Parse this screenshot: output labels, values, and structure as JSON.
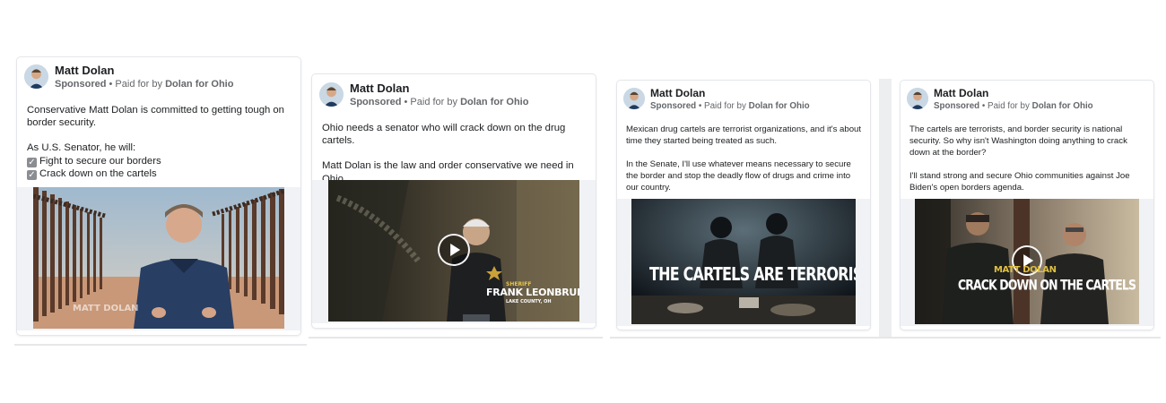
{
  "ads": [
    {
      "advertiser": "Matt Dolan",
      "sponsored": "Sponsored",
      "paid_prefix": "• Paid for by",
      "payer": "Dolan for Ohio",
      "text_lines": [
        "Conservative Matt Dolan is committed to getting tough on border security.",
        "",
        "As U.S. Senator, he will:"
      ],
      "checklist": [
        "Fight to secure our borders",
        "Crack down on the cartels"
      ],
      "video_caption": "MATT DOLAN"
    },
    {
      "advertiser": "Matt Dolan",
      "sponsored": "Sponsored",
      "paid_prefix": "• Paid for by",
      "payer": "Dolan for Ohio",
      "text_lines": [
        "Ohio needs a senator who will crack down on the drug cartels.",
        "",
        "Matt Dolan is the law and order conservative we need in Ohio."
      ],
      "video_caption_small": "SHERIFF",
      "video_caption": "FRANK LEONBRUNO",
      "video_caption_sub": "LAKE COUNTY, OH"
    },
    {
      "advertiser": "Matt Dolan",
      "sponsored": "Sponsored",
      "paid_prefix": "• Paid for by",
      "payer": "Dolan for Ohio",
      "text_lines": [
        "Mexican drug cartels are terrorist organizations, and it's about time they started being treated as such.",
        "",
        "In the Senate, I'll use whatever means necessary to secure the border and stop the deadly flow of drugs and crime into our country."
      ],
      "video_caption": "THE CARTELS ARE TERRORISTS"
    },
    {
      "advertiser": "Matt Dolan",
      "sponsored": "Sponsored",
      "paid_prefix": "• Paid for by",
      "payer": "Dolan for Ohio",
      "text_lines": [
        "The cartels are terrorists, and border security is national security. So why isn't Washington doing anything to crack down at the border?",
        "",
        "I'll stand strong and secure Ohio communities against Joe Biden's open borders agenda."
      ],
      "video_caption_small": "MATT DOLAN",
      "video_caption": "CRACK DOWN ON THE CARTELS"
    }
  ]
}
